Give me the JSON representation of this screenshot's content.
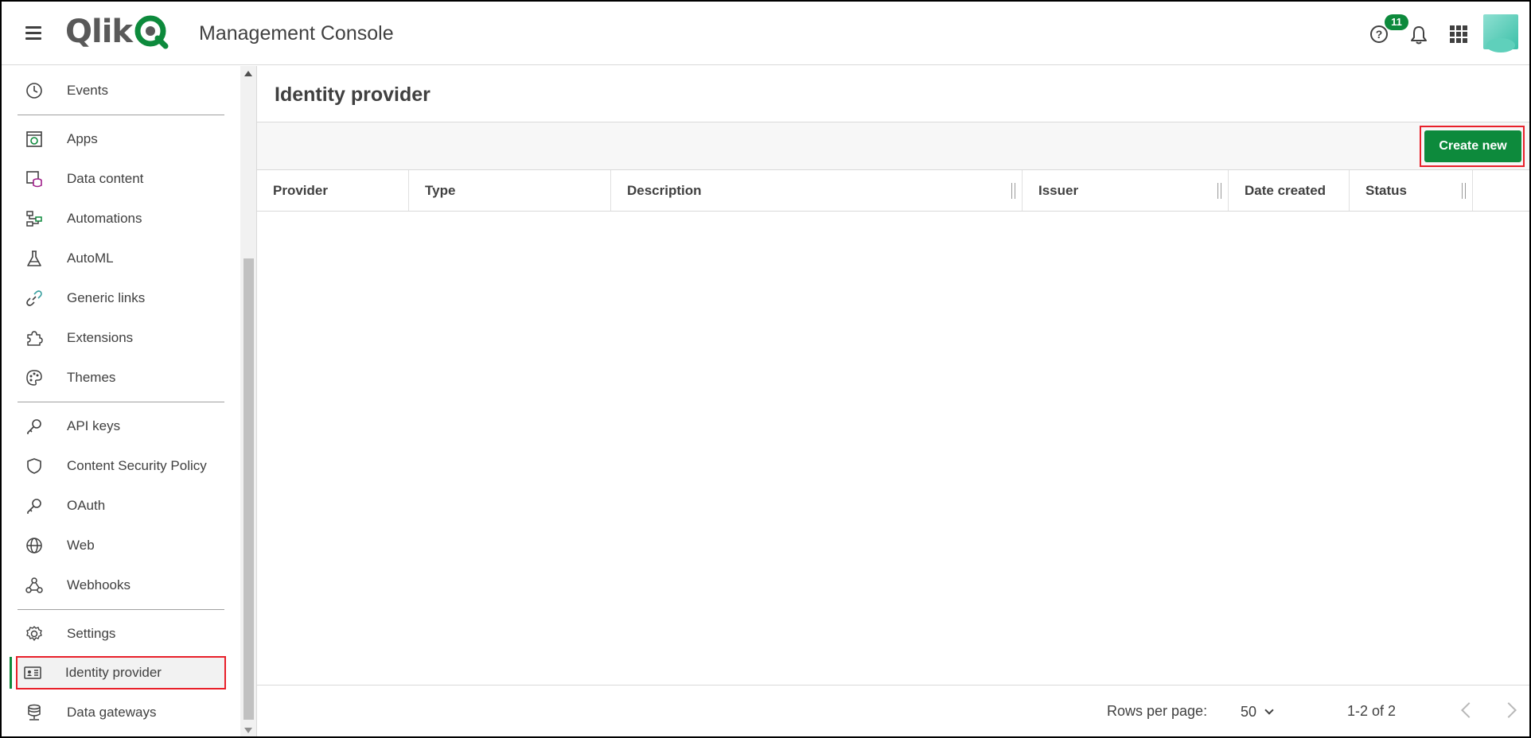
{
  "header": {
    "app_title": "Management Console",
    "logo_text": "Qlik",
    "notification_count": "11"
  },
  "sidebar": {
    "items": [
      {
        "label": "Events",
        "icon": "clock-icon"
      },
      {
        "label": "Apps",
        "icon": "app-icon"
      },
      {
        "label": "Data content",
        "icon": "database-icon"
      },
      {
        "label": "Automations",
        "icon": "automation-icon"
      },
      {
        "label": "AutoML",
        "icon": "flask-icon"
      },
      {
        "label": "Generic links",
        "icon": "link-icon"
      },
      {
        "label": "Extensions",
        "icon": "puzzle-icon"
      },
      {
        "label": "Themes",
        "icon": "palette-icon"
      },
      {
        "label": "API keys",
        "icon": "key-icon"
      },
      {
        "label": "Content Security Policy",
        "icon": "shield-icon"
      },
      {
        "label": "OAuth",
        "icon": "key-icon"
      },
      {
        "label": "Web",
        "icon": "globe-icon"
      },
      {
        "label": "Webhooks",
        "icon": "webhook-icon"
      },
      {
        "label": "Settings",
        "icon": "gear-icon"
      },
      {
        "label": "Identity provider",
        "icon": "id-card-icon"
      },
      {
        "label": "Data gateways",
        "icon": "gateway-icon"
      }
    ],
    "active_item": "Identity provider"
  },
  "main": {
    "page_title": "Identity provider",
    "create_button_label": "Create new",
    "columns": [
      "Provider",
      "Type",
      "Description",
      "Issuer",
      "Date created",
      "Status"
    ],
    "rows": []
  },
  "footer": {
    "rows_per_page_label": "Rows per page:",
    "rows_per_page_value": "50",
    "range_text": "1-2 of 2"
  },
  "colors": {
    "accent_green": "#0d8a3c",
    "highlight_red": "#e8202a"
  }
}
